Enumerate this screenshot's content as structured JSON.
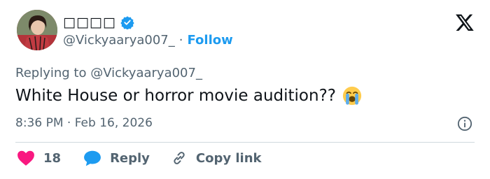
{
  "tweet": {
    "author": {
      "display_name": "□□□□",
      "handle": "@Vickyaarya007_",
      "verified": true,
      "avatar_icon": "user-avatar-photo"
    },
    "follow_label": "Follow",
    "separator": "·",
    "replying_to": "Replying to @Vickyaarya007_",
    "text": "White House or horror movie audition??",
    "emoji_icon": "loudly-crying-face-emoji",
    "timestamp": "8:36 PM · Feb 16, 2026",
    "brand_icon": "x-logo-icon",
    "info_icon": "info-icon"
  },
  "actions": {
    "like_count": "18",
    "reply_label": "Reply",
    "copy_link_label": "Copy link"
  },
  "colors": {
    "accent": "#1d9bf0",
    "like": "#f91880",
    "text_primary": "#0f1419",
    "text_secondary": "#536471",
    "divider": "#cfd9de"
  }
}
